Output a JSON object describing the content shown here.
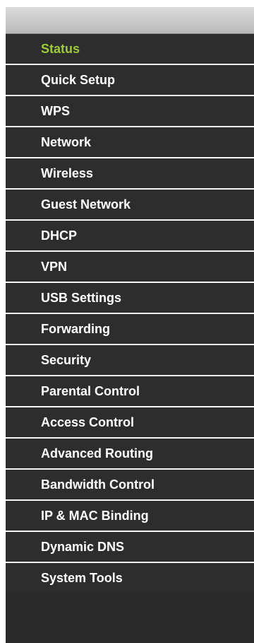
{
  "menu": {
    "active_color": "#9dcb3b",
    "items": [
      {
        "label": "Status",
        "active": true
      },
      {
        "label": "Quick Setup",
        "active": false
      },
      {
        "label": "WPS",
        "active": false
      },
      {
        "label": "Network",
        "active": false
      },
      {
        "label": "Wireless",
        "active": false
      },
      {
        "label": "Guest Network",
        "active": false
      },
      {
        "label": "DHCP",
        "active": false
      },
      {
        "label": "VPN",
        "active": false
      },
      {
        "label": "USB Settings",
        "active": false
      },
      {
        "label": "Forwarding",
        "active": false
      },
      {
        "label": "Security",
        "active": false
      },
      {
        "label": "Parental Control",
        "active": false
      },
      {
        "label": "Access Control",
        "active": false
      },
      {
        "label": "Advanced Routing",
        "active": false
      },
      {
        "label": "Bandwidth Control",
        "active": false
      },
      {
        "label": "IP & MAC Binding",
        "active": false
      },
      {
        "label": "Dynamic DNS",
        "active": false
      },
      {
        "label": "System Tools",
        "active": false
      }
    ]
  }
}
